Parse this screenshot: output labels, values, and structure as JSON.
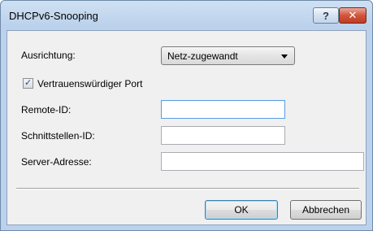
{
  "window": {
    "title": "DHCPv6-Snooping",
    "help_glyph": "?",
    "close_glyph": "✕"
  },
  "form": {
    "ausrichtung_label": "Ausrichtung:",
    "ausrichtung_value": "Netz-zugewandt",
    "trusted_port_label": "Vertrauenswürdiger Port",
    "trusted_port_checked": true,
    "remote_id_label": "Remote-ID:",
    "remote_id_value": "",
    "interface_id_label": "Schnittstellen-ID:",
    "interface_id_value": "",
    "server_address_label": "Server-Adresse:",
    "server_address_value": ""
  },
  "buttons": {
    "ok_label": "OK",
    "cancel_label": "Abbrechen"
  },
  "icons": {
    "help": "help-icon",
    "close": "close-icon",
    "dropdown": "chevron-down-icon",
    "check": "checkmark-icon"
  }
}
